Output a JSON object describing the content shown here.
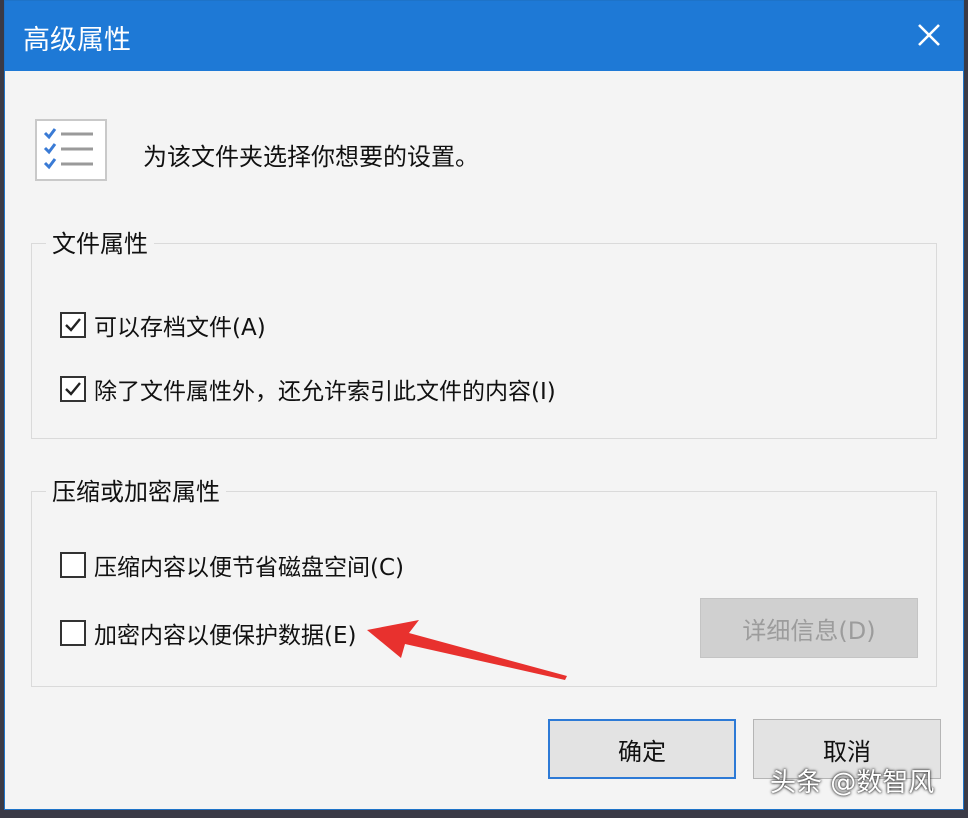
{
  "window": {
    "title": "高级属性",
    "close_icon": "close-icon"
  },
  "header": {
    "icon": "checklist-icon",
    "text": "为该文件夹选择你想要的设置。"
  },
  "file_attributes": {
    "legend": "文件属性",
    "options": [
      {
        "label": "可以存档文件(A)",
        "checked": true
      },
      {
        "label": "除了文件属性外，还允许索引此文件的内容(I)",
        "checked": true
      }
    ]
  },
  "compress_encrypt": {
    "legend": "压缩或加密属性",
    "options": [
      {
        "label": "压缩内容以便节省磁盘空间(C)",
        "checked": false
      },
      {
        "label": "加密内容以便保护数据(E)",
        "checked": false
      }
    ],
    "details_button": "详细信息(D)"
  },
  "buttons": {
    "ok": "确定",
    "cancel": "取消"
  },
  "annotation": {
    "arrow_color": "#e8312e"
  },
  "watermark": "头条 @数智风",
  "colors": {
    "titlebar": "#1e79d6",
    "accent": "#2d7ad6"
  }
}
